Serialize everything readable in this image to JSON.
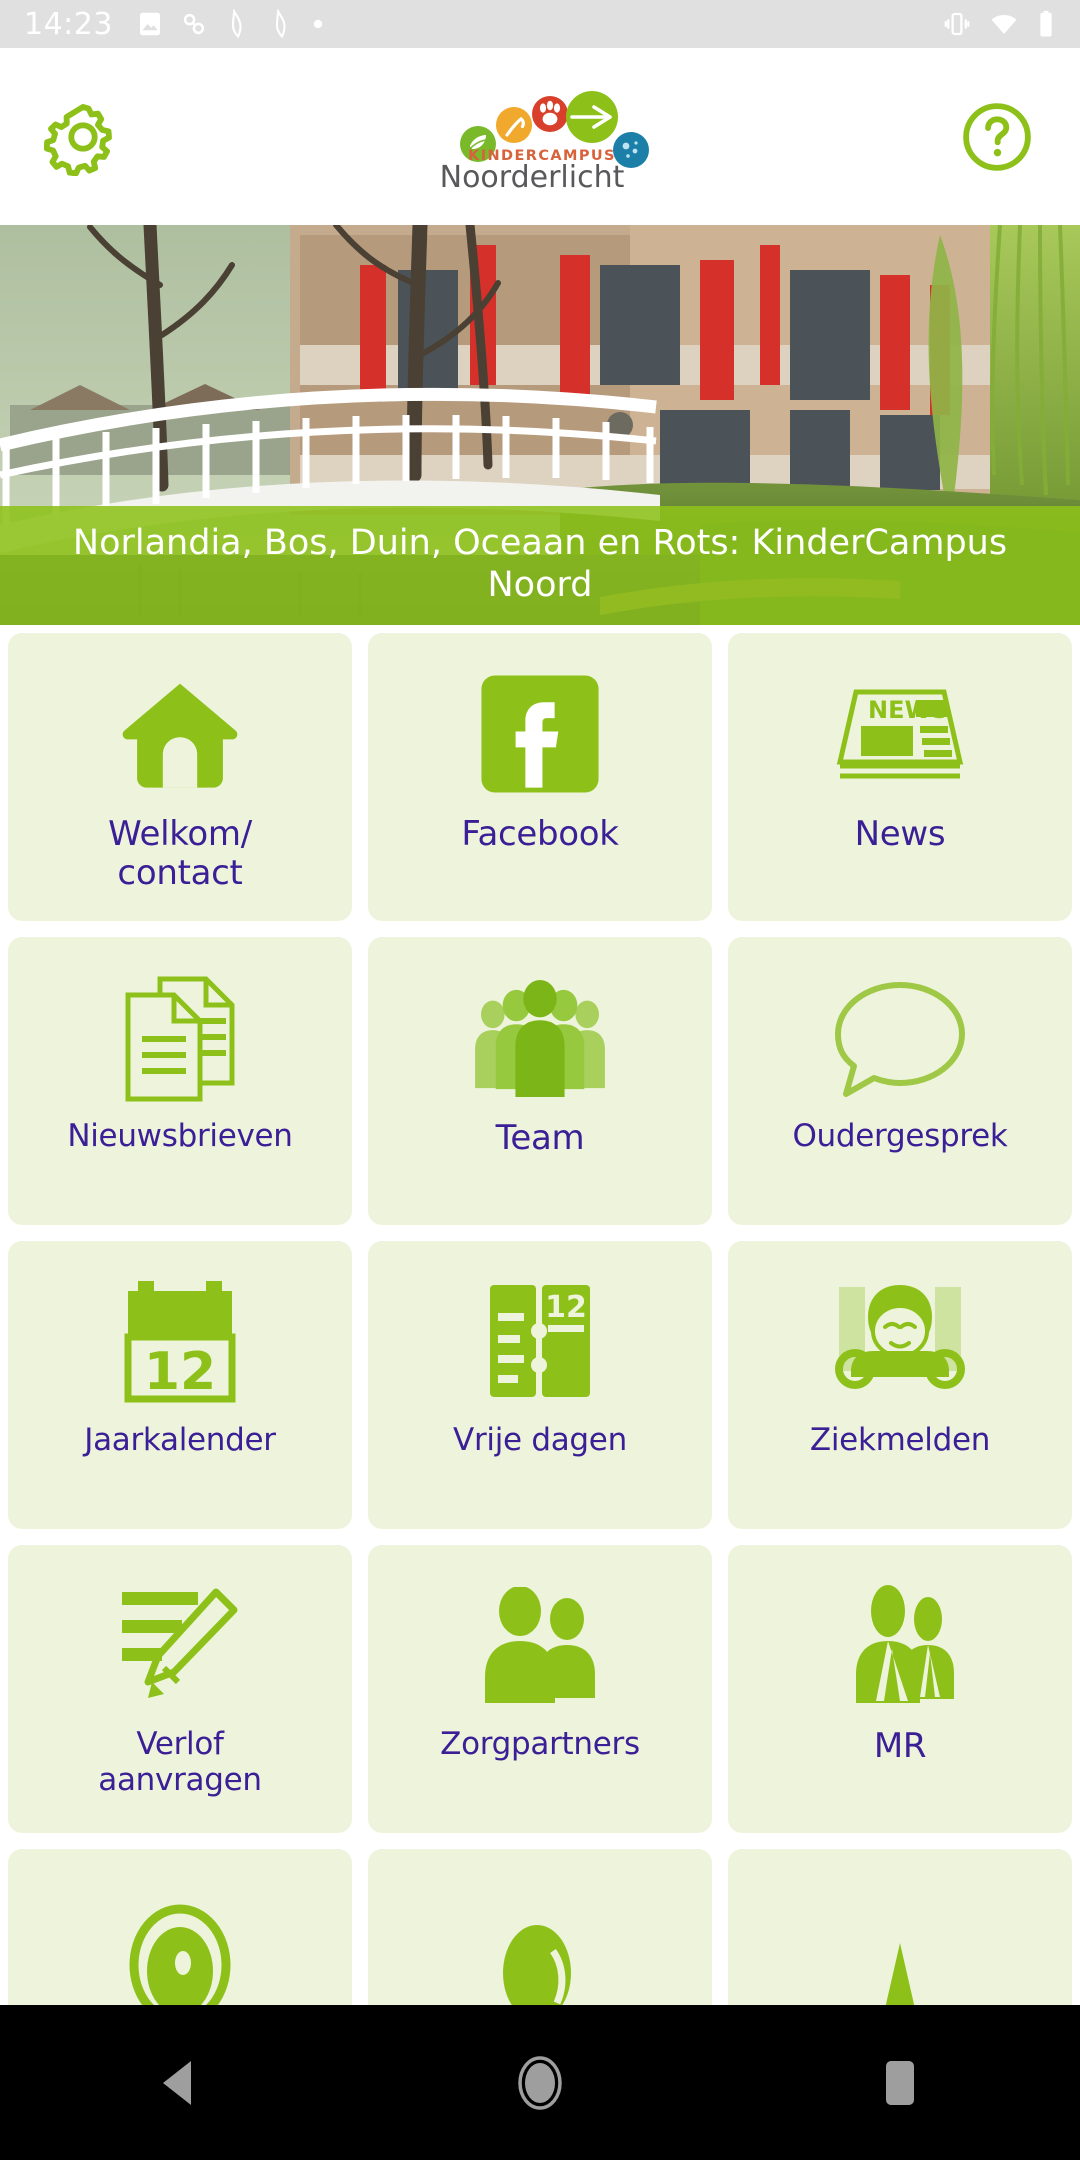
{
  "status_bar": {
    "time": "14:23",
    "left_icons": [
      "image-icon",
      "link-icon",
      "book-icon",
      "book-icon",
      "dot-icon"
    ],
    "right_icons": [
      "vibrate-icon",
      "wifi-icon",
      "battery-icon"
    ],
    "background": "#e0e0e0",
    "foreground": "#ffffff"
  },
  "header": {
    "settings_label": "gear-icon",
    "help_label": "help-icon",
    "logo": {
      "kicker": "KINDERCAMPUS",
      "wordmark": "Noorderlicht",
      "dot_colors": [
        "#7ab929",
        "#f0a92c",
        "#d8402c",
        "#8dc11a",
        "#1b7fa8"
      ]
    },
    "accent": "#8dc11a"
  },
  "hero": {
    "caption": "Norlandia, Bos, Duin, Oceaan en Rots: KinderCampus Noord",
    "caption_bg": "#8dc11a"
  },
  "grid": {
    "tile_bg": "#eef4dc",
    "icon_color": "#8dc11a",
    "label_color": "#3b1f96",
    "tiles": [
      {
        "label": "Welkom/\ncontact",
        "icon": "home-icon"
      },
      {
        "label": "Facebook",
        "icon": "facebook-icon"
      },
      {
        "label": "News",
        "icon": "newspaper-icon"
      },
      {
        "label": "Nieuwsbrieven",
        "icon": "documents-icon"
      },
      {
        "label": "Team",
        "icon": "people-group-icon"
      },
      {
        "label": "Oudergesprek",
        "icon": "speech-bubble-icon"
      },
      {
        "label": "Jaarkalender",
        "icon": "calendar-icon"
      },
      {
        "label": "Vrije dagen",
        "icon": "planner-icon"
      },
      {
        "label": "Ziekmelden",
        "icon": "sick-child-icon"
      },
      {
        "label": "Verlof\naanvragen",
        "icon": "form-pencil-icon"
      },
      {
        "label": "Zorgpartners",
        "icon": "two-persons-icon"
      },
      {
        "label": "MR",
        "icon": "two-suits-icon"
      },
      {
        "label": "",
        "icon": "circle-partial-icon"
      },
      {
        "label": "",
        "icon": "blob-partial-icon"
      },
      {
        "label": "",
        "icon": "tree-partial-icon"
      }
    ],
    "newspaper_masthead": "NEWS",
    "calendar_day": "12",
    "planner_day": "12",
    "facebook_glyph": "f"
  },
  "navigation_bar": {
    "back_label": "back-button",
    "home_label": "home-button",
    "recents_label": "recents-button",
    "background": "#000000"
  }
}
